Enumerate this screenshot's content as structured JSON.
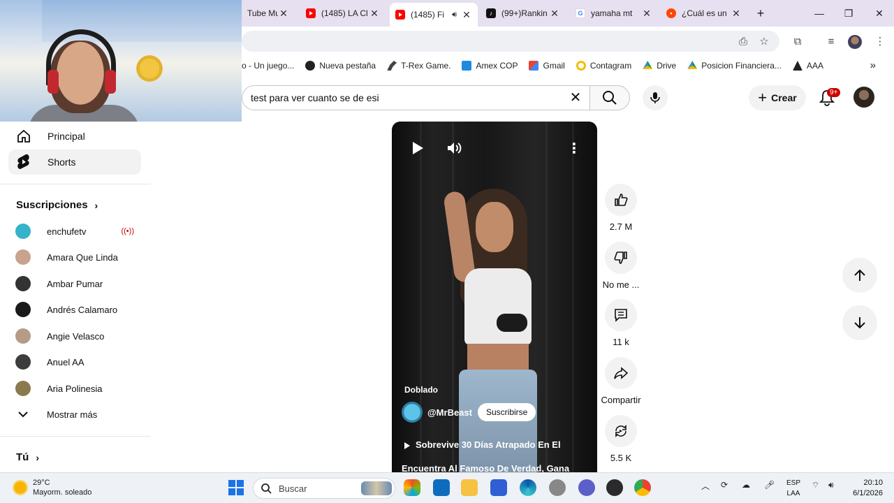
{
  "browser": {
    "tabs": [
      {
        "title": "Tube Mu",
        "icon": "youtube-music-icon"
      },
      {
        "title": "(1485) LA Cl",
        "icon": "youtube-icon"
      },
      {
        "title": "(1485) Fi",
        "icon": "youtube-icon",
        "active": true,
        "audio": true
      },
      {
        "title": "(99+)Rankin",
        "icon": "tiktok-icon"
      },
      {
        "title": "yamaha mt",
        "icon": "google-icon"
      },
      {
        "title": "¿Cuál es un",
        "icon": "reddit-icon"
      }
    ],
    "new_tab": "+",
    "bookmarks": [
      {
        "label": "o - Un juego...",
        "icon": "bookmark-icon"
      },
      {
        "label": "Nueva pestaña",
        "icon": "globe-icon"
      },
      {
        "label": "T-Rex Game.",
        "icon": "dino-icon"
      },
      {
        "label": "Amex COP",
        "icon": "amex-icon"
      },
      {
        "label": "Gmail",
        "icon": "gmail-icon"
      },
      {
        "label": "Contagram",
        "icon": "contagram-icon"
      },
      {
        "label": "Drive",
        "icon": "drive-icon"
      },
      {
        "label": "Posicion Financiera...",
        "icon": "drive-icon"
      },
      {
        "label": "AAA",
        "icon": "aaa-icon"
      }
    ]
  },
  "youtube": {
    "search": {
      "value": "test para ver cuanto se de esi"
    },
    "create_label": "Crear",
    "notifications_badge": "9+",
    "sidebar": {
      "nav": [
        {
          "label": "Principal",
          "icon": "home-icon"
        },
        {
          "label": "Shorts",
          "icon": "shorts-icon",
          "active": true
        }
      ],
      "subscriptions_title": "Suscripciones",
      "subscriptions": [
        {
          "name": "enchufetv",
          "color": "#34b3c9",
          "live": true
        },
        {
          "name": "Amara Que Linda",
          "color": "#c9a38f"
        },
        {
          "name": "Ambar Pumar",
          "color": "#333333"
        },
        {
          "name": "Andrés Calamaro",
          "color": "#1a1a1a"
        },
        {
          "name": "Angie Velasco",
          "color": "#b49c86"
        },
        {
          "name": "Anuel AA",
          "color": "#3c3c3c"
        },
        {
          "name": "Aria Polinesia",
          "color": "#8c7a4f"
        }
      ],
      "show_more": "Mostrar más",
      "you_title": "Tú"
    },
    "short": {
      "tag": "Doblado",
      "channel": "@MrBeast",
      "subscribe_label": "Suscribirse",
      "title_line1": "Sobrevive 30 Días Atrapado En El",
      "title_line2": "Encuentra Al Famoso De Verdad, Gana"
    },
    "actions": {
      "like": "2.7 M",
      "dislike": "No me ...",
      "comments": "11 k",
      "share": "Compartir",
      "remix": "5.5 K"
    }
  },
  "taskbar": {
    "weather_temp": "29°C",
    "weather_desc": "Mayorm. soleado",
    "search_placeholder": "Buscar",
    "lang_top": "ESP",
    "lang_bottom": "LAA",
    "time": "20:10",
    "date": "6/1/2026"
  }
}
